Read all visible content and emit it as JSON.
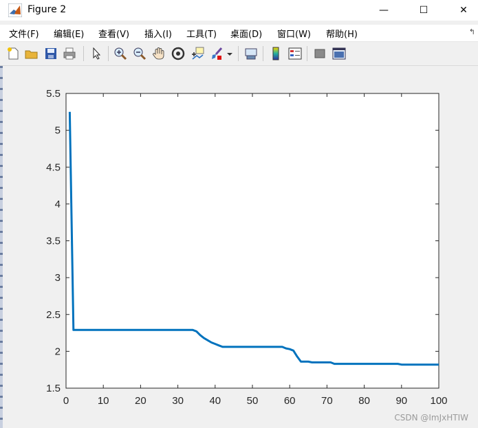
{
  "window": {
    "title": "Figure 2",
    "minimize_glyph": "—",
    "maximize_glyph": "☐",
    "close_glyph": "✕"
  },
  "menu": {
    "items": [
      "文件(F)",
      "编辑(E)",
      "查看(V)",
      "插入(I)",
      "工具(T)",
      "桌面(D)",
      "窗口(W)",
      "帮助(H)"
    ],
    "right_glyph": "↰"
  },
  "toolbar": {
    "icons": [
      "new-figure-icon",
      "open-file-icon",
      "save-icon",
      "print-icon",
      "pointer-icon",
      "zoom-in-icon",
      "zoom-out-icon",
      "pan-hand-icon",
      "rotate-3d-icon",
      "data-cursor-icon",
      "brush-icon",
      "brush-dropdown-icon",
      "link-plot-icon",
      "colorbar-icon",
      "legend-icon",
      "hide-plot-tools-icon",
      "show-plot-tools-icon"
    ]
  },
  "watermark": "CSDN @ImJxHTIW",
  "colors": {
    "line": "#0072bd",
    "axes_bg": "#ffffff",
    "figure_bg": "#f0f0f0"
  },
  "chart_data": {
    "type": "line",
    "title": "",
    "xlabel": "",
    "ylabel": "",
    "xlim": [
      0,
      100
    ],
    "ylim": [
      1.5,
      5.5
    ],
    "xticks": [
      0,
      10,
      20,
      30,
      40,
      50,
      60,
      70,
      80,
      90,
      100
    ],
    "yticks": [
      1.5,
      2,
      2.5,
      3,
      3.5,
      4,
      4.5,
      5,
      5.5
    ],
    "xtick_labels": [
      "0",
      "10",
      "20",
      "30",
      "40",
      "50",
      "60",
      "70",
      "80",
      "90",
      "100"
    ],
    "ytick_labels": [
      "1.5",
      "2",
      "2.5",
      "3",
      "3.5",
      "4",
      "4.5",
      "5",
      "5.5"
    ],
    "grid": false,
    "series": [
      {
        "x": [
          1,
          2,
          10,
          20,
          30,
          34,
          35,
          36,
          37,
          38,
          39,
          40,
          41,
          42,
          45,
          50,
          55,
          58,
          59,
          60,
          61,
          62,
          63,
          64,
          65,
          66,
          70,
          71,
          72,
          75,
          80,
          85,
          89,
          90,
          95,
          100
        ],
        "y": [
          5.25,
          2.29,
          2.29,
          2.29,
          2.29,
          2.29,
          2.27,
          2.22,
          2.18,
          2.15,
          2.12,
          2.1,
          2.08,
          2.06,
          2.06,
          2.06,
          2.06,
          2.06,
          2.04,
          2.03,
          2.01,
          1.93,
          1.86,
          1.86,
          1.86,
          1.85,
          1.85,
          1.85,
          1.83,
          1.83,
          1.83,
          1.83,
          1.83,
          1.82,
          1.82,
          1.82
        ]
      }
    ]
  }
}
